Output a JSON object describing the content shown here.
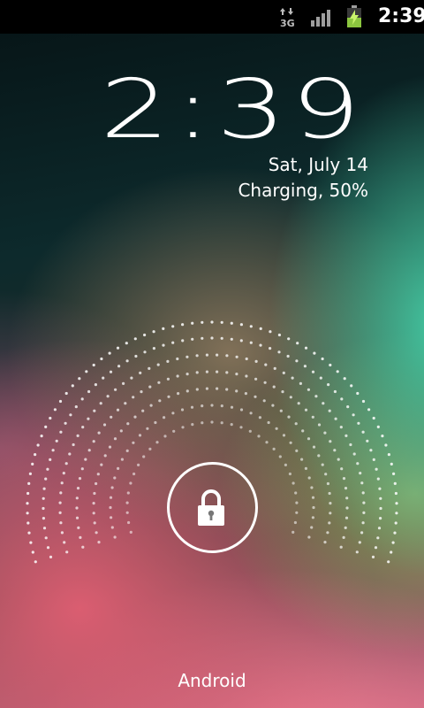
{
  "status_bar": {
    "network_type": "3G",
    "time": "2:39",
    "icons": [
      "data-3g-icon",
      "signal-strength-icon",
      "battery-charging-icon"
    ],
    "signal_bars": 4,
    "battery_level": 0.5
  },
  "lockscreen": {
    "clock": "2:39",
    "date": "Sat, July 14",
    "charging_status": "Charging, 50%",
    "carrier": "Android",
    "unlock_icon": "lock-icon"
  },
  "colors": {
    "status_bar_bg": "#000000",
    "battery_green": "#8cc63f",
    "text": "#ffffff"
  }
}
